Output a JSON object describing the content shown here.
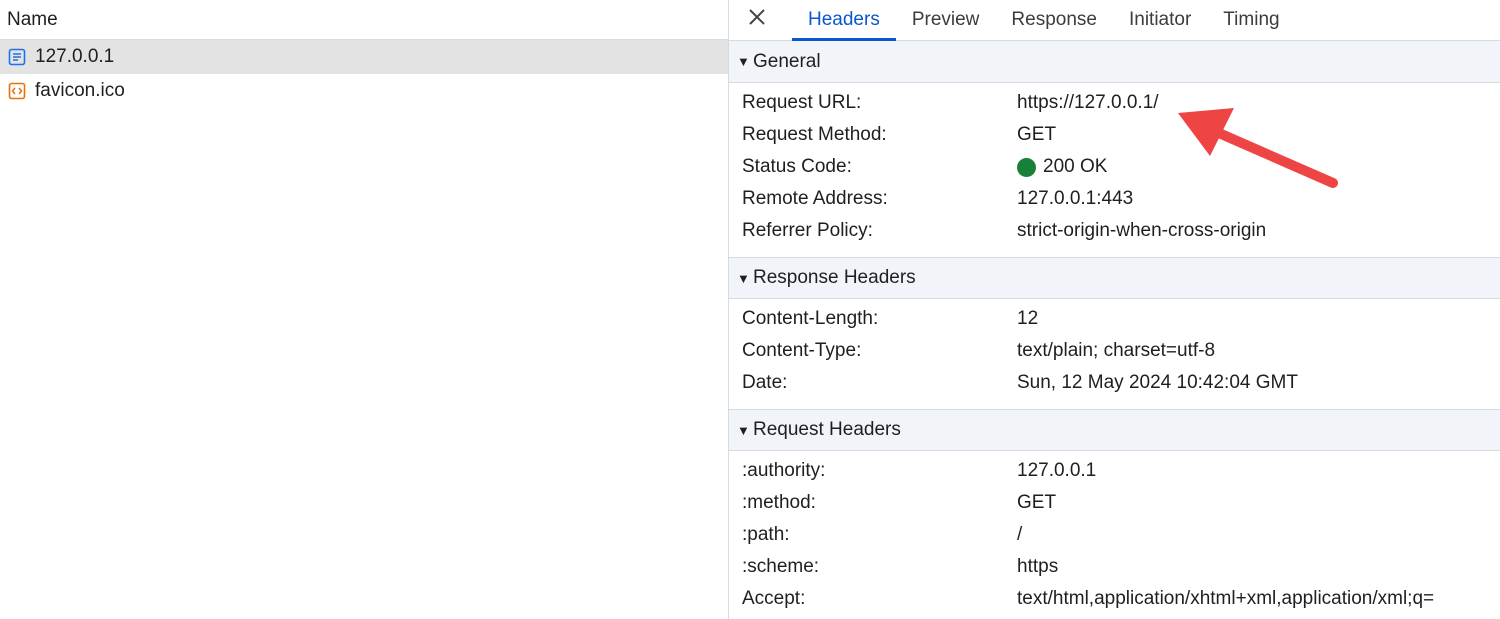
{
  "left": {
    "header": "Name",
    "requests": [
      {
        "name": "127.0.0.1",
        "icon": "document-icon",
        "selected": true
      },
      {
        "name": "favicon.ico",
        "icon": "code-file-icon",
        "selected": false
      }
    ]
  },
  "tabs": [
    "Headers",
    "Preview",
    "Response",
    "Initiator",
    "Timing"
  ],
  "active_tab": "Headers",
  "sections": {
    "general": {
      "title": "General",
      "rows": [
        {
          "key": "Request URL:",
          "value": "https://127.0.0.1/"
        },
        {
          "key": "Request Method:",
          "value": "GET"
        },
        {
          "key": "Status Code:",
          "value": "200 OK"
        },
        {
          "key": "Remote Address:",
          "value": "127.0.0.1:443"
        },
        {
          "key": "Referrer Policy:",
          "value": "strict-origin-when-cross-origin"
        }
      ]
    },
    "response": {
      "title": "Response Headers",
      "rows": [
        {
          "key": "Content-Length:",
          "value": "12"
        },
        {
          "key": "Content-Type:",
          "value": "text/plain; charset=utf-8"
        },
        {
          "key": "Date:",
          "value": "Sun, 12 May 2024 10:42:04 GMT"
        }
      ]
    },
    "request": {
      "title": "Request Headers",
      "rows": [
        {
          "key": ":authority:",
          "value": "127.0.0.1"
        },
        {
          "key": ":method:",
          "value": "GET"
        },
        {
          "key": ":path:",
          "value": "/"
        },
        {
          "key": ":scheme:",
          "value": "https"
        },
        {
          "key": "Accept:",
          "value": "text/html,application/xhtml+xml,application/xml;q="
        }
      ]
    }
  },
  "colors": {
    "accent": "#0b57d0",
    "status_ok": "#188038",
    "annotation_arrow": "#ef4444",
    "section_bg": "#f1f4f9",
    "selected_row": "#e3e3e3"
  }
}
